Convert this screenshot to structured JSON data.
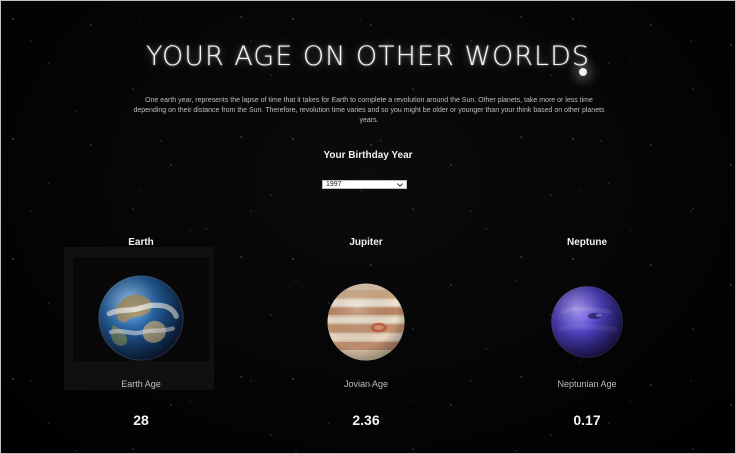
{
  "header": {
    "title": "YOUR AGE ON OTHER WORLDS",
    "intro": "One earth year, represents the lapse of time that it takes for Earth to complete a revolution around the Sun. Other planets, take more or less time depending on their distance from the Sun. Therefore, revolution time varies and so you might be older or younger than your think based on other planets years."
  },
  "birthday": {
    "title": "Your Birthday Year",
    "selected": "1997"
  },
  "planets": [
    {
      "name": "Earth",
      "age_label": "Earth Age",
      "age_value": "28"
    },
    {
      "name": "Jupiter",
      "age_label": "Jovian Age",
      "age_value": "2.36"
    },
    {
      "name": "Neptune",
      "age_label": "Neptunian  Age",
      "age_value": "0.17"
    }
  ],
  "icons": {
    "select_caret": "chevron-down-icon"
  }
}
